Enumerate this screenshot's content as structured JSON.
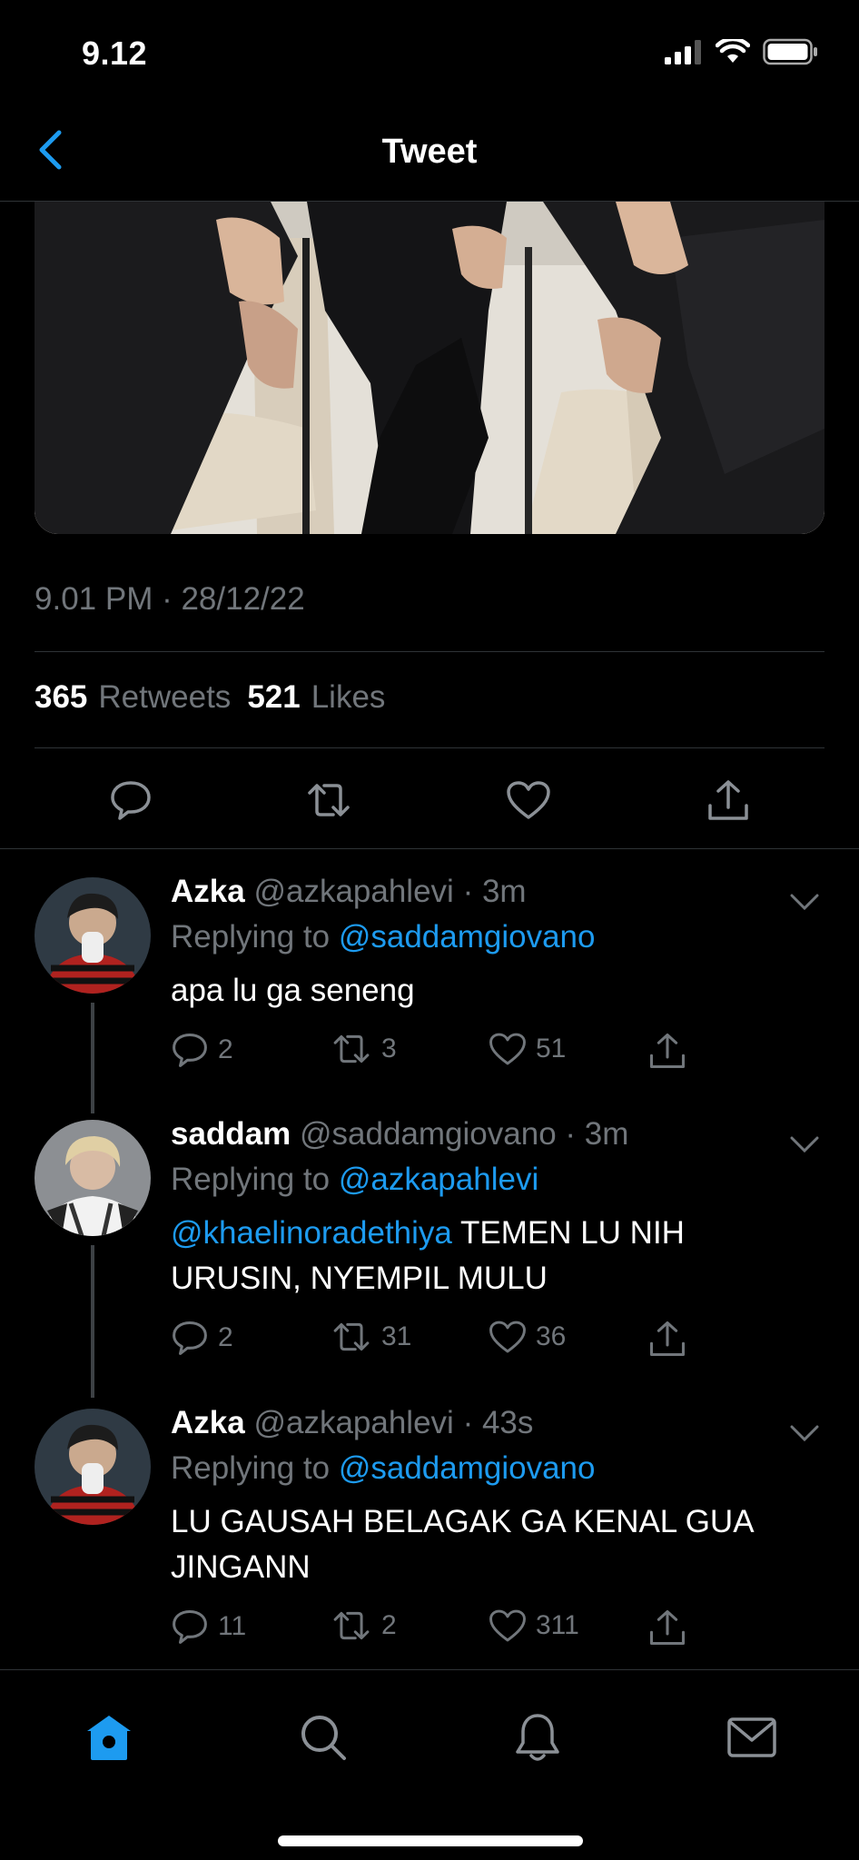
{
  "status": {
    "time": "9.12"
  },
  "header": {
    "title": "Tweet"
  },
  "tweet": {
    "timestamp": "9.01 PM · 28/12/22",
    "retweets_count": "365",
    "retweets_label": "Retweets",
    "likes_count": "521",
    "likes_label": "Likes"
  },
  "replies": [
    {
      "name": "Azka",
      "handle": "@azkapahlevi",
      "time": "· 3m",
      "replying_label": "Replying to",
      "replying_to": "@saddamgiovano",
      "mention": "",
      "text": "apa lu ga seneng",
      "comments": "2",
      "retweets": "3",
      "likes": "51"
    },
    {
      "name": "saddam",
      "handle": "@saddamgiovano",
      "time": "· 3m",
      "replying_label": "Replying to",
      "replying_to": "@azkapahlevi",
      "mention": "@khaelinoradethiya",
      "text": " TEMEN LU NIH URUSIN, NYEMPIL MULU",
      "comments": "2",
      "retweets": "31",
      "likes": "36"
    },
    {
      "name": "Azka",
      "handle": "@azkapahlevi",
      "time": "· 43s",
      "replying_label": "Replying to",
      "replying_to": "@saddamgiovano",
      "mention": "",
      "text": "LU GAUSAH BELAGAK GA KENAL GUA JINGANN",
      "comments": "11",
      "retweets": "2",
      "likes": "311"
    }
  ],
  "colors": {
    "accent": "#1d9bf0",
    "muted": "#71767b",
    "background": "#000000"
  },
  "icons": [
    "back-chevron-icon",
    "reply-icon",
    "retweet-icon",
    "like-icon",
    "share-icon",
    "home-icon",
    "search-icon",
    "bell-icon",
    "mail-icon"
  ]
}
